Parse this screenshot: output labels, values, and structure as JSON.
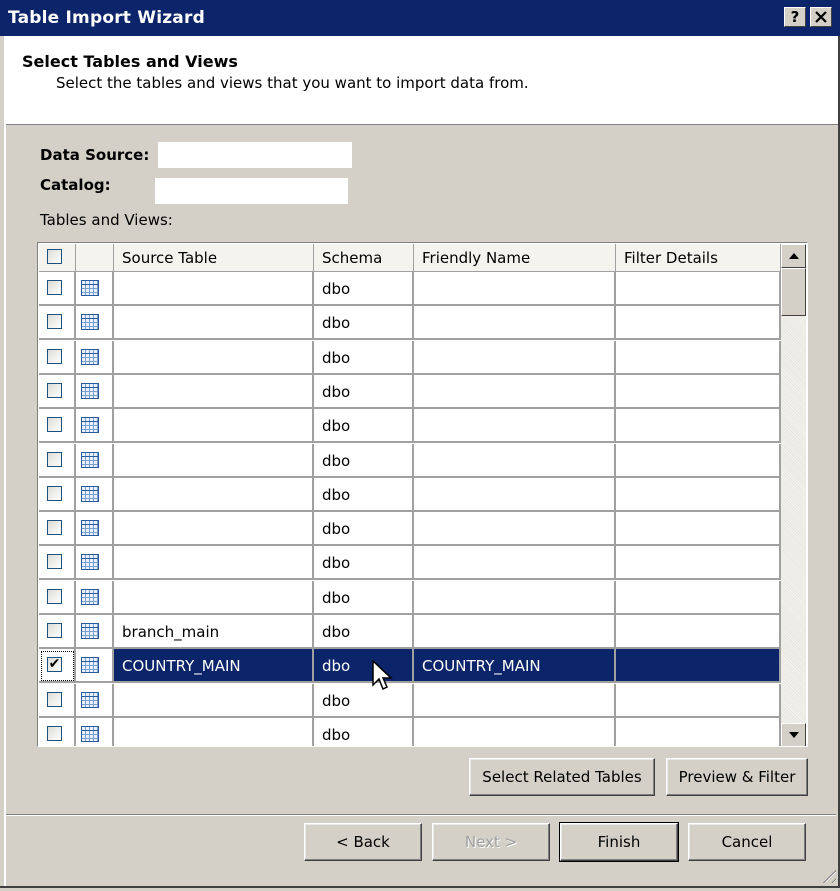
{
  "window": {
    "title": "Table Import Wizard",
    "help_label": "?",
    "close_label": "X"
  },
  "header": {
    "title": "Select Tables and Views",
    "subtitle": "Select the tables and views that you want to import data from."
  },
  "form": {
    "data_source_label": "Data Source:",
    "data_source_value": "",
    "catalog_label": "Catalog:",
    "catalog_value": "",
    "tables_label": "Tables and Views:"
  },
  "grid": {
    "columns": [
      "",
      "",
      "Source Table",
      "Schema",
      "Friendly Name",
      "Filter Details"
    ],
    "rows": [
      {
        "checked": false,
        "source": "",
        "schema": "dbo",
        "friendly": "",
        "filter": ""
      },
      {
        "checked": false,
        "source": "",
        "schema": "dbo",
        "friendly": "",
        "filter": ""
      },
      {
        "checked": false,
        "source": "",
        "schema": "dbo",
        "friendly": "",
        "filter": ""
      },
      {
        "checked": false,
        "source": "",
        "schema": "dbo",
        "friendly": "",
        "filter": ""
      },
      {
        "checked": false,
        "source": "",
        "schema": "dbo",
        "friendly": "",
        "filter": ""
      },
      {
        "checked": false,
        "source": "",
        "schema": "dbo",
        "friendly": "",
        "filter": ""
      },
      {
        "checked": false,
        "source": "",
        "schema": "dbo",
        "friendly": "",
        "filter": ""
      },
      {
        "checked": false,
        "source": "",
        "schema": "dbo",
        "friendly": "",
        "filter": ""
      },
      {
        "checked": false,
        "source": "",
        "schema": "dbo",
        "friendly": "",
        "filter": ""
      },
      {
        "checked": false,
        "source": "",
        "schema": "dbo",
        "friendly": "",
        "filter": ""
      },
      {
        "checked": false,
        "source": "branch_main",
        "schema": "dbo",
        "friendly": "",
        "filter": ""
      },
      {
        "checked": true,
        "selected": true,
        "source": "COUNTRY_MAIN",
        "schema": "dbo",
        "friendly": "COUNTRY_MAIN",
        "filter": ""
      },
      {
        "checked": false,
        "source": "",
        "schema": "dbo",
        "friendly": "",
        "filter": ""
      },
      {
        "checked": false,
        "source": "",
        "schema": "dbo",
        "friendly": "",
        "filter": ""
      }
    ]
  },
  "buttons": {
    "select_related": "Select Related Tables",
    "preview_filter": "Preview & Filter",
    "back": "< Back",
    "next": "Next >",
    "finish": "Finish",
    "cancel": "Cancel"
  }
}
